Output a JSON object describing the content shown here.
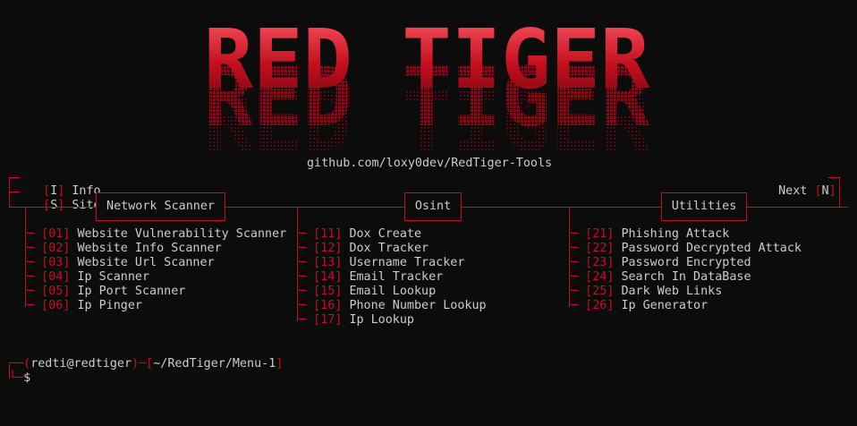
{
  "banner": {
    "text": "RED TIGER"
  },
  "github": "github.com/loxy0dev/RedTiger-Tools",
  "top_left": [
    {
      "key": "I",
      "label": "Info"
    },
    {
      "key": "S",
      "label": "Site"
    }
  ],
  "top_right": {
    "label": "Next",
    "key": "N"
  },
  "sections": [
    {
      "title": "Network Scanner",
      "items": [
        {
          "num": "01",
          "label": "Website Vulnerability Scanner"
        },
        {
          "num": "02",
          "label": "Website Info Scanner"
        },
        {
          "num": "03",
          "label": "Website Url Scanner"
        },
        {
          "num": "04",
          "label": "Ip Scanner"
        },
        {
          "num": "05",
          "label": "Ip Port Scanner"
        },
        {
          "num": "06",
          "label": "Ip Pinger"
        }
      ]
    },
    {
      "title": "Osint",
      "items": [
        {
          "num": "11",
          "label": "Dox Create"
        },
        {
          "num": "12",
          "label": "Dox Tracker"
        },
        {
          "num": "13",
          "label": "Username Tracker"
        },
        {
          "num": "14",
          "label": "Email Tracker"
        },
        {
          "num": "15",
          "label": "Email Lookup"
        },
        {
          "num": "16",
          "label": "Phone Number Lookup"
        },
        {
          "num": "17",
          "label": "Ip Lookup"
        }
      ]
    },
    {
      "title": "Utilities",
      "items": [
        {
          "num": "21",
          "label": "Phishing Attack"
        },
        {
          "num": "22",
          "label": "Password Decrypted Attack"
        },
        {
          "num": "23",
          "label": "Password Encrypted"
        },
        {
          "num": "24",
          "label": "Search In DataBase"
        },
        {
          "num": "25",
          "label": "Dark Web Links"
        },
        {
          "num": "26",
          "label": "Ip Generator"
        }
      ]
    }
  ],
  "prompt": {
    "user_host": "redti@redtiger",
    "path": "~/RedTiger/Menu-1",
    "symbol": "$"
  },
  "colors": {
    "accent": "#c50f1f",
    "text": "#cccccc",
    "background": "#0c0c0c"
  }
}
